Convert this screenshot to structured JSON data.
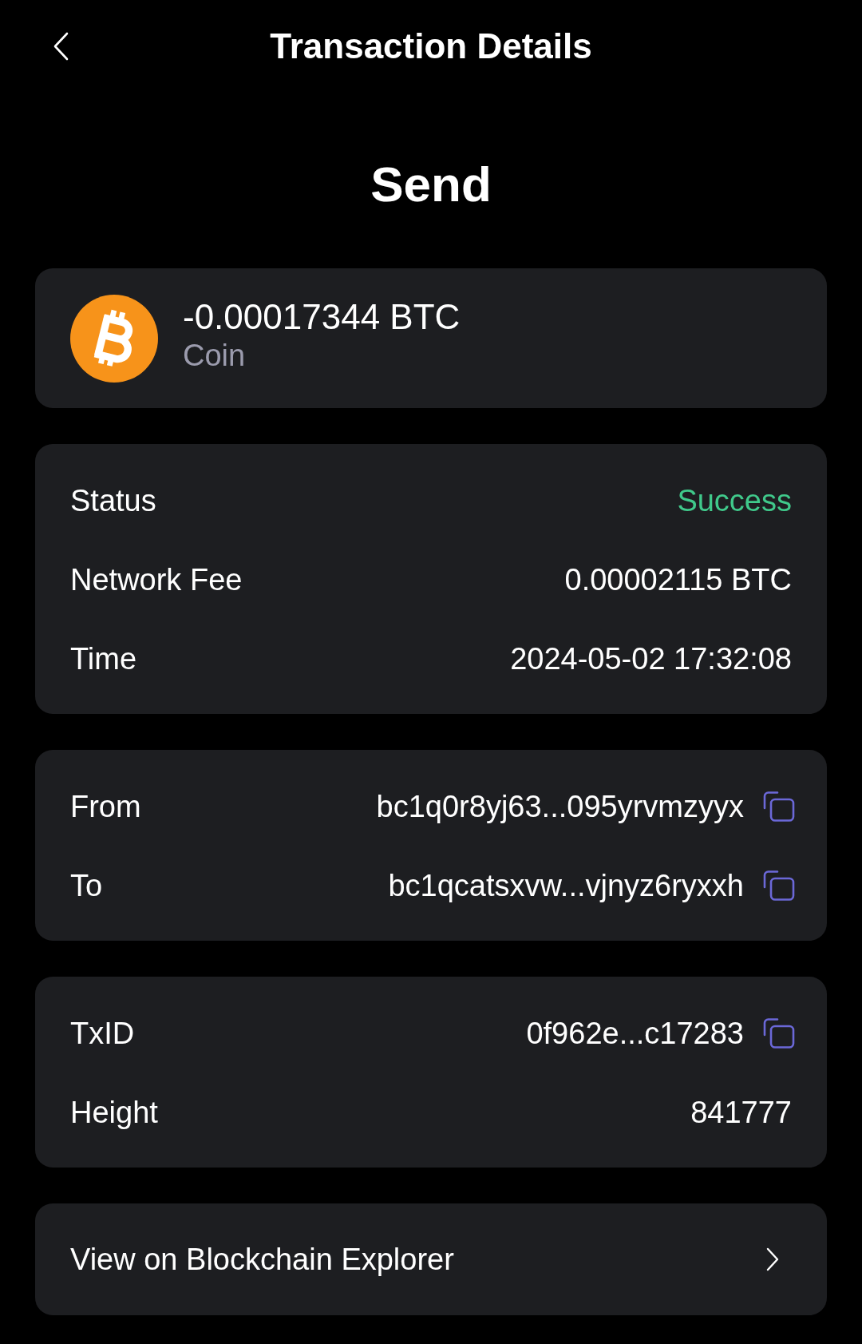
{
  "header": {
    "title": "Transaction Details"
  },
  "type_heading": "Send",
  "asset": {
    "amount": "-0.00017344 BTC",
    "label": "Coin"
  },
  "sections": [
    {
      "rows": [
        {
          "label": "Status",
          "value": "Success",
          "kind": "status"
        },
        {
          "label": "Network Fee",
          "value": "0.00002115 BTC",
          "kind": "plain"
        },
        {
          "label": "Time",
          "value": "2024-05-02 17:32:08",
          "kind": "plain"
        }
      ]
    },
    {
      "rows": [
        {
          "label": "From",
          "value": "bc1q0r8yj63...095yrvmzyyx",
          "kind": "copyable"
        },
        {
          "label": "To",
          "value": "bc1qcatsxvw...vjnyz6ryxxh",
          "kind": "copyable"
        }
      ]
    },
    {
      "rows": [
        {
          "label": "TxID",
          "value": "0f962e...c17283",
          "kind": "copyable"
        },
        {
          "label": "Height",
          "value": "841777",
          "kind": "plain"
        }
      ]
    }
  ],
  "explorer_link": {
    "label": "View on Blockchain Explorer"
  }
}
